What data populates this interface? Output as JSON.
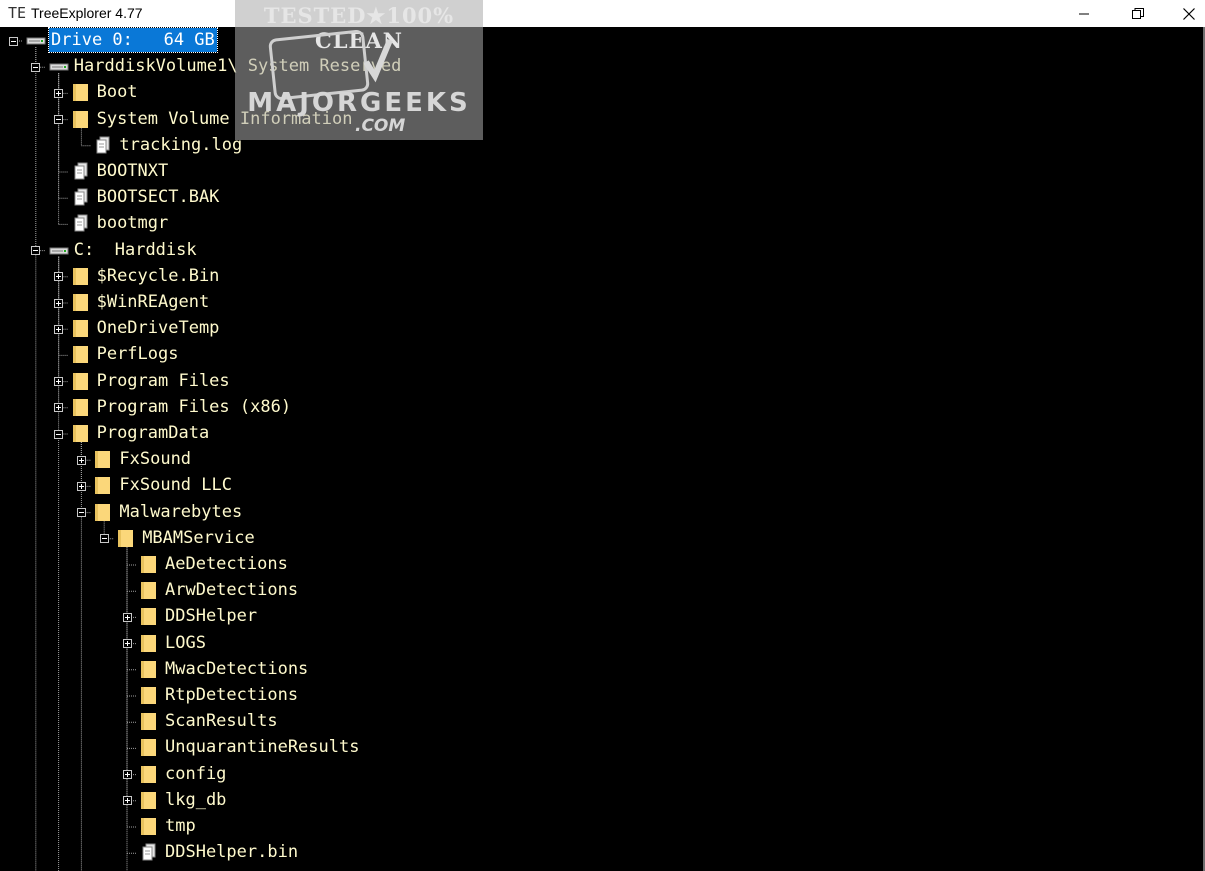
{
  "window": {
    "title": "TreeExplorer 4.77",
    "app_icon_glyph": "TE",
    "buttons": {
      "minimize": "minimize-icon",
      "restore": "restore-icon",
      "close": "close-icon"
    }
  },
  "watermark": {
    "top_text": "TESTED★100% CLEAN",
    "main_text": "MAJORGEEKS",
    "suffix_text": ".COM"
  },
  "colors": {
    "background": "#000000",
    "text": "#fffacd",
    "folder": "#fbd77a",
    "selection": "#0a78d7",
    "tree_line": "#a0a0a0"
  },
  "tree": [
    {
      "label": "Drive 0:   64 GB",
      "depth": 0,
      "type": "disk",
      "toggle": "minus",
      "selected": true
    },
    {
      "label": "HarddiskVolume1\\ System Reserved",
      "depth": 1,
      "type": "disk",
      "toggle": "minus"
    },
    {
      "label": "Boot",
      "depth": 2,
      "type": "folder",
      "toggle": "plus"
    },
    {
      "label": "System Volume Information",
      "depth": 2,
      "type": "folder",
      "toggle": "minus"
    },
    {
      "label": "tracking.log",
      "depth": 3,
      "type": "file",
      "toggle": "none"
    },
    {
      "label": "BOOTNXT",
      "depth": 2,
      "type": "file",
      "toggle": "none"
    },
    {
      "label": "BOOTSECT.BAK",
      "depth": 2,
      "type": "file",
      "toggle": "none"
    },
    {
      "label": "bootmgr",
      "depth": 2,
      "type": "file",
      "toggle": "none"
    },
    {
      "label": "C:  Harddisk",
      "depth": 1,
      "type": "disk",
      "toggle": "minus"
    },
    {
      "label": "$Recycle.Bin",
      "depth": 2,
      "type": "folder",
      "toggle": "plus"
    },
    {
      "label": "$WinREAgent",
      "depth": 2,
      "type": "folder",
      "toggle": "plus"
    },
    {
      "label": "OneDriveTemp",
      "depth": 2,
      "type": "folder",
      "toggle": "plus"
    },
    {
      "label": "PerfLogs",
      "depth": 2,
      "type": "folder",
      "toggle": "none"
    },
    {
      "label": "Program Files",
      "depth": 2,
      "type": "folder",
      "toggle": "plus"
    },
    {
      "label": "Program Files (x86)",
      "depth": 2,
      "type": "folder",
      "toggle": "plus"
    },
    {
      "label": "ProgramData",
      "depth": 2,
      "type": "folder",
      "toggle": "minus"
    },
    {
      "label": "FxSound",
      "depth": 3,
      "type": "folder",
      "toggle": "plus"
    },
    {
      "label": "FxSound LLC",
      "depth": 3,
      "type": "folder",
      "toggle": "plus"
    },
    {
      "label": "Malwarebytes",
      "depth": 3,
      "type": "folder",
      "toggle": "minus"
    },
    {
      "label": "MBAMService",
      "depth": 4,
      "type": "folder",
      "toggle": "minus"
    },
    {
      "label": "AeDetections",
      "depth": 5,
      "type": "folder",
      "toggle": "none"
    },
    {
      "label": "ArwDetections",
      "depth": 5,
      "type": "folder",
      "toggle": "none"
    },
    {
      "label": "DDSHelper",
      "depth": 5,
      "type": "folder",
      "toggle": "plus"
    },
    {
      "label": "LOGS",
      "depth": 5,
      "type": "folder",
      "toggle": "plus"
    },
    {
      "label": "MwacDetections",
      "depth": 5,
      "type": "folder",
      "toggle": "none"
    },
    {
      "label": "RtpDetections",
      "depth": 5,
      "type": "folder",
      "toggle": "none"
    },
    {
      "label": "ScanResults",
      "depth": 5,
      "type": "folder",
      "toggle": "none"
    },
    {
      "label": "UnquarantineResults",
      "depth": 5,
      "type": "folder",
      "toggle": "none"
    },
    {
      "label": "config",
      "depth": 5,
      "type": "folder",
      "toggle": "plus"
    },
    {
      "label": "lkg_db",
      "depth": 5,
      "type": "folder",
      "toggle": "plus"
    },
    {
      "label": "tmp",
      "depth": 5,
      "type": "folder",
      "toggle": "none"
    },
    {
      "label": "DDSHelper.bin",
      "depth": 5,
      "type": "file",
      "toggle": "none"
    }
  ]
}
